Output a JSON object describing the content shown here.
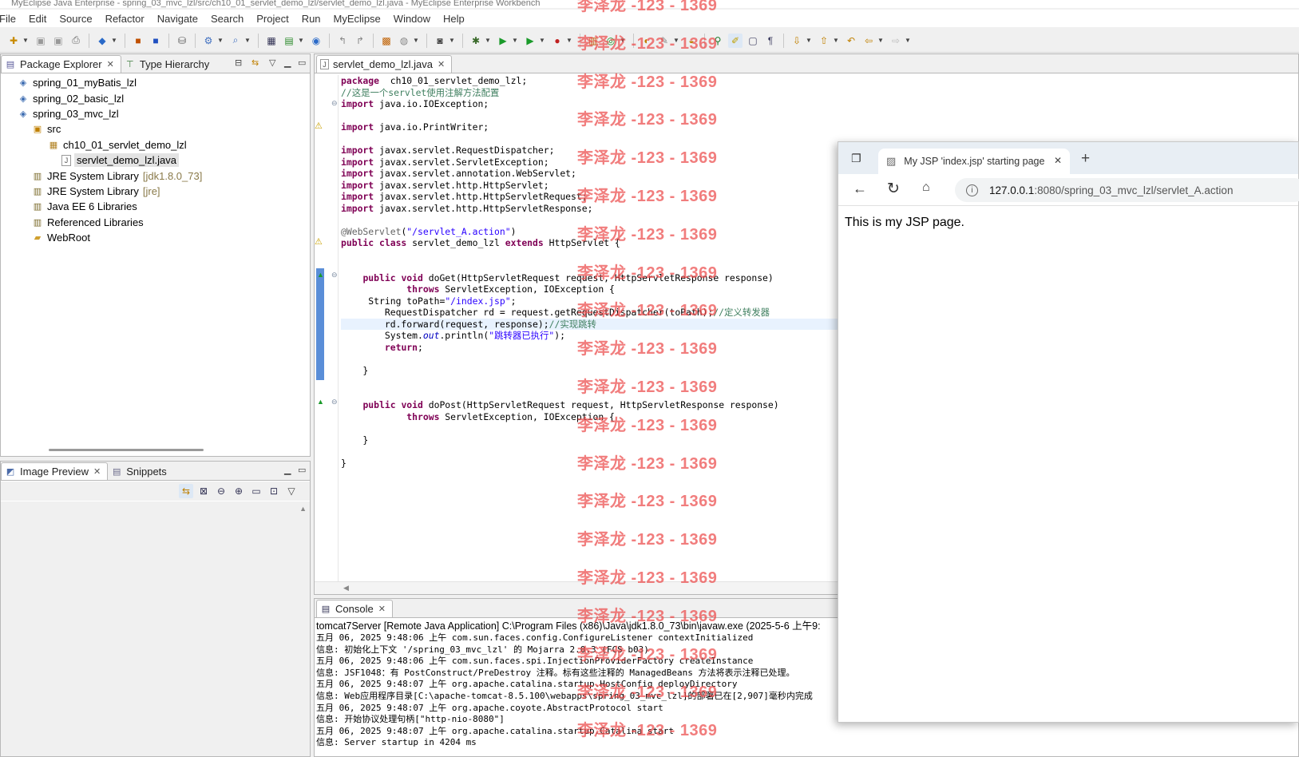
{
  "window": {
    "title": "MyEclipse Java Enterprise - spring_03_mvc_lzl/src/ch10_01_servlet_demo_lzl/servlet_demo_lzl.java - MyEclipse Enterprise Workbench"
  },
  "menu": [
    "File",
    "Edit",
    "Source",
    "Refactor",
    "Navigate",
    "Search",
    "Project",
    "Run",
    "MyEclipse",
    "Window",
    "Help"
  ],
  "explorer": {
    "tabs": [
      {
        "label": "Package Explorer",
        "icon": "package-explorer-icon"
      },
      {
        "label": "Type Hierarchy",
        "icon": "type-hierarchy-icon"
      }
    ],
    "items": [
      {
        "label": "spring_01_myBatis_lzl",
        "suffix": "",
        "icon": "project-icon",
        "level": 1
      },
      {
        "label": "spring_02_basic_lzl",
        "suffix": "",
        "icon": "project-icon",
        "level": 1
      },
      {
        "label": "spring_03_mvc_lzl",
        "suffix": "",
        "icon": "project-icon",
        "level": 1
      },
      {
        "label": "src",
        "suffix": "",
        "icon": "source-folder-icon",
        "level": 2
      },
      {
        "label": "ch10_01_servlet_demo_lzl",
        "suffix": "",
        "icon": "package-icon",
        "level": 3
      },
      {
        "label": "servlet_demo_lzl.java",
        "suffix": "",
        "icon": "java-file-icon",
        "level": 4
      },
      {
        "label": "JRE System Library",
        "suffix": "[jdk1.8.0_73]",
        "icon": "library-icon",
        "level": 2
      },
      {
        "label": "JRE System Library",
        "suffix": "[jre]",
        "icon": "library-icon",
        "level": 2
      },
      {
        "label": "Java EE 6 Libraries",
        "suffix": "",
        "icon": "library-icon",
        "level": 2
      },
      {
        "label": "Referenced Libraries",
        "suffix": "",
        "icon": "library-icon",
        "level": 2
      },
      {
        "label": "WebRoot",
        "suffix": "",
        "icon": "folder-icon",
        "level": 2
      }
    ]
  },
  "preview": {
    "tabs": [
      {
        "label": "Image Preview",
        "icon": "image-preview-icon"
      },
      {
        "label": "Snippets",
        "icon": "snippets-icon"
      }
    ]
  },
  "editor": {
    "tab": "servlet_demo_lzl.java",
    "lines": [
      [
        [
          "kw",
          "package"
        ],
        [
          "",
          "  ch10_01_servlet_demo_lzl;"
        ]
      ],
      [
        [
          "cmt",
          "//这是一个servlet使用注解方法配置"
        ]
      ],
      [
        [
          "kw",
          "import"
        ],
        [
          "",
          " java.io.IOException;"
        ]
      ],
      [],
      [
        [
          "kw",
          "import"
        ],
        [
          "",
          " java.io.PrintWriter;"
        ]
      ],
      [],
      [
        [
          "kw",
          "import"
        ],
        [
          "",
          " javax.servlet.RequestDispatcher;"
        ]
      ],
      [
        [
          "kw",
          "import"
        ],
        [
          "",
          " javax.servlet.ServletException;"
        ]
      ],
      [
        [
          "kw",
          "import"
        ],
        [
          "",
          " javax.servlet.annotation.WebServlet;"
        ]
      ],
      [
        [
          "kw",
          "import"
        ],
        [
          "",
          " javax.servlet.http.HttpServlet;"
        ]
      ],
      [
        [
          "kw",
          "import"
        ],
        [
          "",
          " javax.servlet.http.HttpServletRequest;"
        ]
      ],
      [
        [
          "kw",
          "import"
        ],
        [
          "",
          " javax.servlet.http.HttpServletResponse;"
        ]
      ],
      [],
      [
        [
          "ann",
          "@WebServlet"
        ],
        [
          "",
          "("
        ],
        [
          "str",
          "\"/servlet_A.action\""
        ],
        [
          "",
          ")"
        ]
      ],
      [
        [
          "kw",
          "public class"
        ],
        [
          "",
          " servlet_demo_lzl "
        ],
        [
          "kw",
          "extends"
        ],
        [
          "",
          " HttpServlet {"
        ]
      ],
      [],
      [],
      [
        [
          "",
          "    "
        ],
        [
          "kw",
          "public void"
        ],
        [
          "",
          " doGet(HttpServletRequest request, HttpServletResponse response)"
        ]
      ],
      [
        [
          "",
          "            "
        ],
        [
          "kw",
          "throws"
        ],
        [
          "",
          " ServletException, IOException {"
        ]
      ],
      [
        [
          "",
          "     String toPath="
        ],
        [
          "str",
          "\"/index.jsp\""
        ],
        [
          "",
          ";"
        ]
      ],
      [
        [
          "",
          "        RequestDispatcher rd = request.getRequestDispatcher(toPath);"
        ],
        [
          "cmt",
          "//定义转发器"
        ]
      ],
      [
        [
          "",
          "        rd.forward(request, response);"
        ],
        [
          "cmt",
          "//实现跳转"
        ]
      ],
      [
        [
          "",
          "        System."
        ],
        [
          "it",
          "out"
        ],
        [
          "",
          ".println("
        ],
        [
          "str",
          "\"跳转器已执行\""
        ],
        [
          "",
          ");"
        ]
      ],
      [
        [
          "",
          "        "
        ],
        [
          "kw",
          "return"
        ],
        [
          "",
          ";"
        ]
      ],
      [],
      [
        [
          "",
          "    }"
        ]
      ],
      [],
      [],
      [
        [
          "",
          "    "
        ],
        [
          "kw",
          "public void"
        ],
        [
          "",
          " doPost(HttpServletRequest request, HttpServletResponse response)"
        ]
      ],
      [
        [
          "",
          "            "
        ],
        [
          "kw",
          "throws"
        ],
        [
          "",
          " ServletException, IOException {"
        ]
      ],
      [],
      [
        [
          "",
          "    }"
        ]
      ],
      [],
      [
        [
          "",
          "}"
        ]
      ]
    ]
  },
  "console": {
    "tab": "Console",
    "header": "tomcat7Server [Remote Java Application] C:\\Program Files (x86)\\Java\\jdk1.8.0_73\\bin\\javaw.exe (2025-5-6 上午9:",
    "lines": [
      "五月 06, 2025 9:48:06 上午 com.sun.faces.config.ConfigureListener contextInitialized",
      "信息: 初始化上下文 '/spring_03_mvc_lzl' 的 Mojarra 2.0.3 (FCS b03)",
      "五月 06, 2025 9:48:06 上午 com.sun.faces.spi.InjectionProviderFactory createInstance",
      "信息: JSF1048：有 PostConstruct/PreDestroy 注释。标有这些注释的 ManagedBeans 方法将表示注释已处理。",
      "五月 06, 2025 9:48:07 上午 org.apache.catalina.startup.HostConfig deployDirectory",
      "信息: Web应用程序目录[C:\\apache-tomcat-8.5.100\\webapps\\spring_03_mvc_lzl]的部署已在[2,907]毫秒内完成",
      "五月 06, 2025 9:48:07 上午 org.apache.coyote.AbstractProtocol start",
      "信息: 开始协议处理句柄[\"http-nio-8080\"]",
      "五月 06, 2025 9:48:07 上午 org.apache.catalina.startup.Catalina start",
      "信息: Server startup in 4204 ms"
    ]
  },
  "browser": {
    "tab_title": "My JSP 'index.jsp' starting page",
    "url_host": "127.0.0.1",
    "url_rest": ":8080/spring_03_mvc_lzl/servlet_A.action",
    "content": "This is my JSP page."
  },
  "watermark": {
    "text": "李泽龙 -123 - 1369",
    "count": 20
  },
  "colors": {
    "keyword": "#7f0055",
    "string": "#2a00ff",
    "comment": "#3f7f5f",
    "watermark": "#eb4b4b"
  }
}
